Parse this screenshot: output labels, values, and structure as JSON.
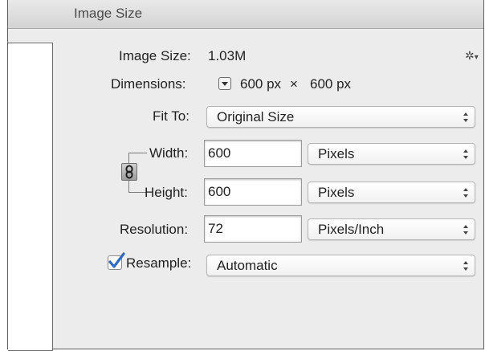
{
  "dialog": {
    "title": "Image Size"
  },
  "image_size": {
    "label": "Image Size:",
    "value": "1.03M"
  },
  "dimensions": {
    "label": "Dimensions:",
    "width": "600 px",
    "times": "×",
    "height": "600 px"
  },
  "fit_to": {
    "label": "Fit To:",
    "value": "Original Size"
  },
  "width": {
    "label": "Width:",
    "value": "600",
    "unit": "Pixels"
  },
  "height": {
    "label": "Height:",
    "value": "600",
    "unit": "Pixels"
  },
  "resolution": {
    "label": "Resolution:",
    "value": "72",
    "unit": "Pixels/Inch"
  },
  "resample": {
    "label": "Resample:",
    "checked": true,
    "value": "Automatic"
  },
  "icons": {
    "settings": "gear-icon",
    "constrain": "chain-link-icon",
    "annotation": "red-arrow-icon",
    "dimensions_toggle": "triangle-down-icon"
  },
  "colors": {
    "arrow": "#e8231d",
    "checkmark": "#2d6bc4",
    "panel": "#ececec"
  }
}
